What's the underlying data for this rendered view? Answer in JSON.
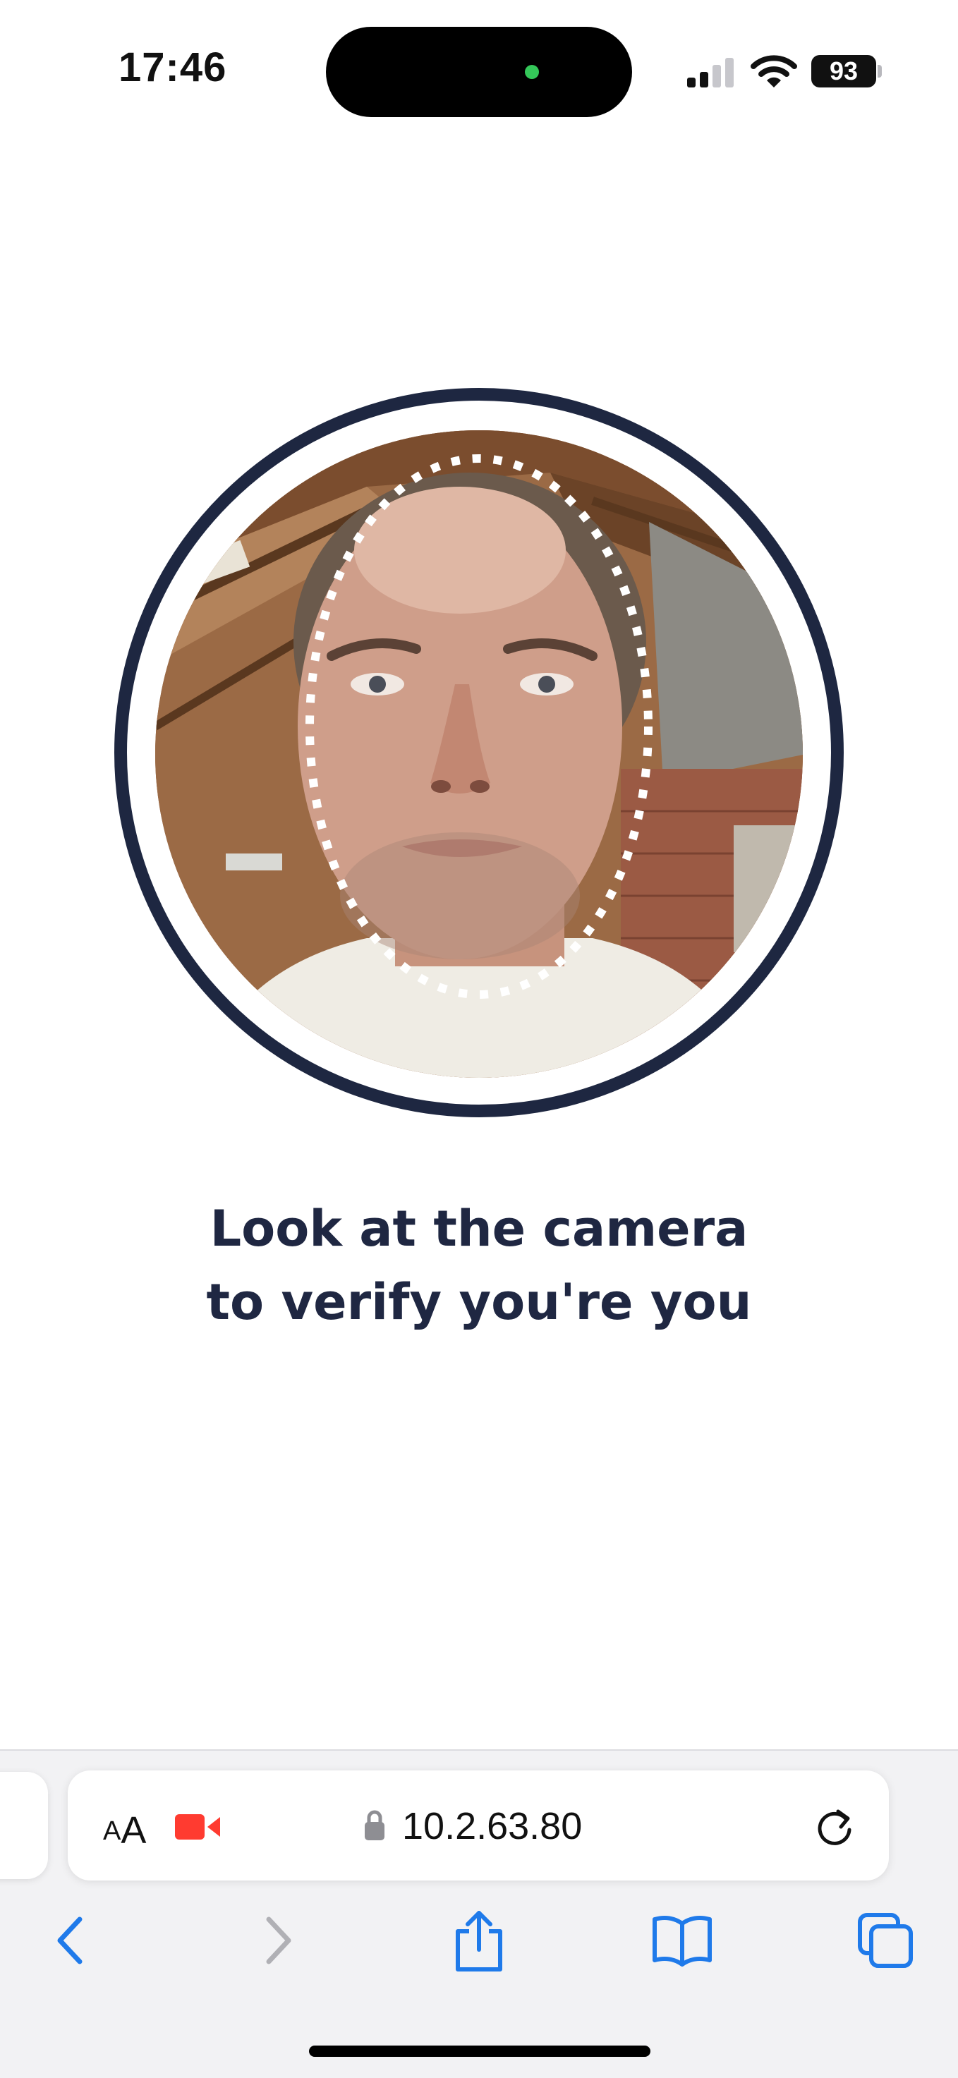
{
  "status_bar": {
    "time": "17:46",
    "battery_level": "93",
    "signal_bars_active": 2,
    "signal_bars_total": 4
  },
  "face_capture": {
    "ring_color": "#1e2741",
    "guide_color": "#ffffff",
    "guide_style": "dotted-oval"
  },
  "instruction": {
    "line1": "Look at the camera",
    "line2": "to verify you're you"
  },
  "browser": {
    "text_size_small": "A",
    "text_size_large": "A",
    "url": "10.2.63.80",
    "recording_color": "#ff3b30",
    "accent_color": "#1f7aea"
  }
}
